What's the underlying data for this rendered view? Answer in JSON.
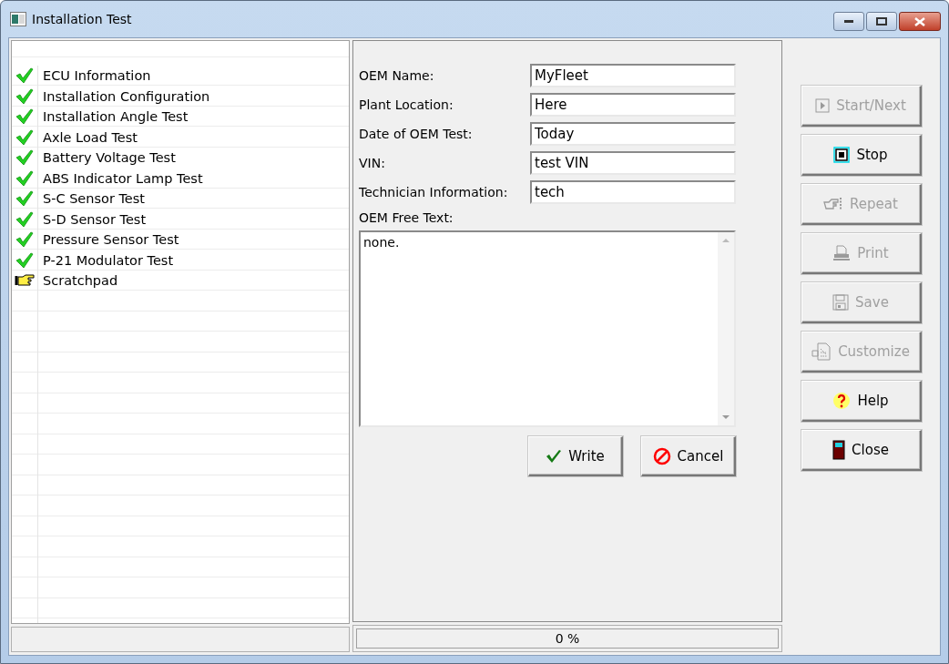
{
  "window": {
    "title": "Installation Test"
  },
  "test_list": [
    {
      "label": "ECU Information",
      "kind": "done"
    },
    {
      "label": "Installation Configuration",
      "kind": "done"
    },
    {
      "label": "Installation Angle Test",
      "kind": "done"
    },
    {
      "label": "Axle Load Test",
      "kind": "done"
    },
    {
      "label": "Battery Voltage Test",
      "kind": "done"
    },
    {
      "label": "ABS Indicator Lamp Test",
      "kind": "done"
    },
    {
      "label": "S-C Sensor Test",
      "kind": "done"
    },
    {
      "label": "S-D Sensor Test",
      "kind": "done"
    },
    {
      "label": "Pressure Sensor Test",
      "kind": "done"
    },
    {
      "label": "P-21 Modulator Test",
      "kind": "done"
    },
    {
      "label": "Scratchpad",
      "kind": "current"
    }
  ],
  "form": {
    "fields": [
      {
        "label": "OEM Name:",
        "value": "MyFleet"
      },
      {
        "label": "Plant Location:",
        "value": "Here"
      },
      {
        "label": "Date of OEM Test:",
        "value": "Today"
      },
      {
        "label": "VIN:",
        "value": "test VIN"
      },
      {
        "label": "Technician Information:",
        "value": "tech"
      }
    ],
    "free_text": {
      "label": "OEM Free Text:",
      "value": "none."
    },
    "buttons": [
      {
        "label": "Write",
        "kind": "write"
      },
      {
        "label": "Cancel",
        "kind": "cancel"
      }
    ]
  },
  "progress": {
    "reading": "0 %"
  },
  "side_buttons": [
    {
      "label": "Start/Next",
      "kind": "start",
      "disabled": true
    },
    {
      "label": "Stop",
      "kind": "stop",
      "disabled": false
    },
    {
      "label": "Repeat",
      "kind": "repeat",
      "disabled": true
    },
    {
      "label": "Print",
      "kind": "print",
      "disabled": true
    },
    {
      "label": "Save",
      "kind": "save",
      "disabled": true
    },
    {
      "label": "Customize",
      "kind": "customize",
      "disabled": true
    },
    {
      "label": "Help",
      "kind": "help",
      "disabled": false
    },
    {
      "label": "Close",
      "kind": "close",
      "disabled": false
    }
  ]
}
